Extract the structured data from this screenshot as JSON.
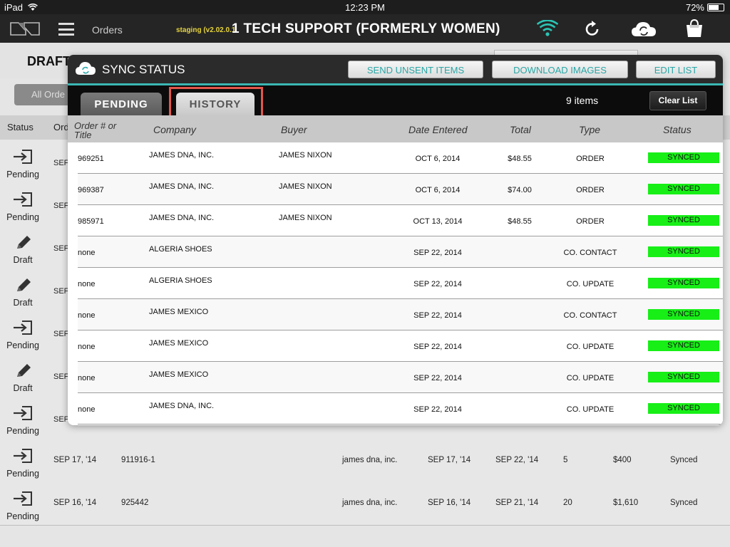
{
  "status_bar": {
    "device": "iPad",
    "time": "12:23 PM",
    "battery": "72%"
  },
  "app_bar": {
    "orders_label": "Orders",
    "staging": "staging (v2.02.0.1",
    "title": "1 TECH SUPPORT (FORMERLY WOMEN)"
  },
  "background": {
    "page_title": "DRAFT",
    "filter_button": "All Orde",
    "columns": {
      "status": "Status",
      "order": "Ord"
    },
    "rows": [
      {
        "status": "Pending",
        "icon": "submit-icon",
        "peek": "SEF"
      },
      {
        "status": "Pending",
        "icon": "submit-icon",
        "peek": "SEF"
      },
      {
        "status": "Draft",
        "icon": "pencil-icon",
        "peek": "SEF"
      },
      {
        "status": "Draft",
        "icon": "pencil-icon",
        "peek": "SEF"
      },
      {
        "status": "Pending",
        "icon": "submit-icon",
        "peek": "SEF"
      },
      {
        "status": "Draft",
        "icon": "pencil-icon",
        "peek": "SEF"
      },
      {
        "status": "Pending",
        "icon": "submit-icon",
        "peek": "SEF"
      },
      {
        "status": "Pending",
        "icon": "submit-icon",
        "date": "SEP 17, '14",
        "order": "911916-1",
        "company": "james dna, inc.",
        "entered": "SEP 17, '14",
        "ship": "SEP 22, '14",
        "qty": "5",
        "total": "$400",
        "sync": "Synced"
      },
      {
        "status": "Pending",
        "icon": "submit-icon",
        "date": "SEP 16, '14",
        "order": "925442",
        "company": "james dna, inc.",
        "entered": "SEP 16, '14",
        "ship": "SEP 21, '14",
        "qty": "20",
        "total": "$1,610",
        "sync": "Synced"
      }
    ]
  },
  "modal": {
    "title": "SYNC STATUS",
    "buttons": {
      "send": "SEND UNSENT ITEMS",
      "download": "DOWNLOAD IMAGES",
      "edit": "EDIT LIST"
    },
    "tabs": {
      "pending": "PENDING",
      "history": "HISTORY",
      "active": "HISTORY"
    },
    "item_count": "9 items",
    "clear_label": "Clear List",
    "headers": {
      "order_line1": "Order #  or",
      "order_line2": "Title",
      "company": "Company",
      "buyer": "Buyer",
      "date": "Date Entered",
      "total": "Total",
      "type": "Type",
      "status": "Status"
    },
    "rows": [
      {
        "order": "969251",
        "company": "JAMES DNA, INC.",
        "buyer": "JAMES NIXON",
        "date": "OCT 6, 2014",
        "total": "$48.55",
        "type": "ORDER",
        "status": "SYNCED"
      },
      {
        "order": "969387",
        "company": "JAMES DNA, INC.",
        "buyer": "JAMES NIXON",
        "date": "OCT 6, 2014",
        "total": "$74.00",
        "type": "ORDER",
        "status": "SYNCED"
      },
      {
        "order": "985971",
        "company": "JAMES DNA, INC.",
        "buyer": "JAMES NIXON",
        "date": "OCT 13, 2014",
        "total": "$48.55",
        "type": "ORDER",
        "status": "SYNCED"
      },
      {
        "order": "none",
        "company": "ALGERIA SHOES",
        "buyer": "",
        "date": "SEP 22, 2014",
        "total": "",
        "type": "CO. CONTACT",
        "status": "SYNCED"
      },
      {
        "order": "none",
        "company": "ALGERIA SHOES",
        "buyer": "",
        "date": "SEP 22, 2014",
        "total": "",
        "type": "CO. UPDATE",
        "status": "SYNCED"
      },
      {
        "order": "none",
        "company": "JAMES MEXICO",
        "buyer": "",
        "date": "SEP 22, 2014",
        "total": "",
        "type": "CO. CONTACT",
        "status": "SYNCED"
      },
      {
        "order": "none",
        "company": "JAMES MEXICO",
        "buyer": "",
        "date": "SEP 22, 2014",
        "total": "",
        "type": "CO. UPDATE",
        "status": "SYNCED"
      },
      {
        "order": "none",
        "company": "JAMES MEXICO",
        "buyer": "",
        "date": "SEP 22, 2014",
        "total": "",
        "type": "CO. UPDATE",
        "status": "SYNCED"
      },
      {
        "order": "none",
        "company": "JAMES DNA, INC.",
        "buyer": "",
        "date": "SEP 22, 2014",
        "total": "",
        "type": "CO. UPDATE",
        "status": "SYNCED"
      }
    ]
  },
  "colors": {
    "accent_teal": "#3bb7b3",
    "synced_green": "#17ef17",
    "highlight_red": "#e3574b",
    "wifi_teal": "#2bc4b4"
  }
}
